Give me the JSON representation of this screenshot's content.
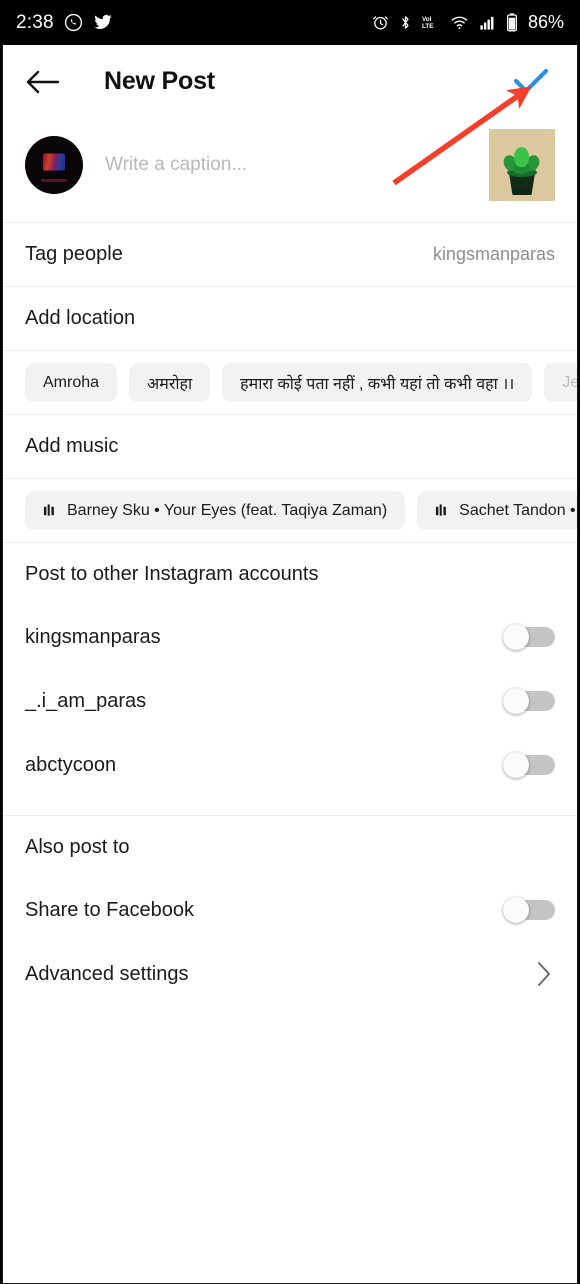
{
  "status_bar": {
    "time": "2:38",
    "battery_text": "86%",
    "left_icons": [
      "whatsapp-icon",
      "twitter-icon"
    ],
    "right_icons": [
      "alarm-icon",
      "bluetooth-icon",
      "volte-icon",
      "wifi-icon",
      "signal-icon",
      "battery-icon"
    ]
  },
  "header": {
    "back_label": "back-arrow",
    "title": "New Post",
    "share_label": "share-checkmark",
    "accent_color": "#2e8fe0"
  },
  "caption": {
    "placeholder": "Write a caption...",
    "avatar_label": "user-avatar",
    "thumbnail_label": "post-thumbnail"
  },
  "tag_people": {
    "label": "Tag people",
    "value": "kingsmanparas"
  },
  "add_location": {
    "label": "Add location",
    "chips": [
      {
        "text": "Amroha",
        "faded": false
      },
      {
        "text": "अमरोहा",
        "faded": false
      },
      {
        "text": "हमारा कोई पता नहीं , कभी यहां तो कभी वहा ।।",
        "faded": false
      },
      {
        "text": "Jewelle",
        "faded": true
      }
    ]
  },
  "add_music": {
    "label": "Add music",
    "chips": [
      {
        "text": "Barney Sku • Your Eyes (feat. Taqiya Zaman)",
        "faded": false
      },
      {
        "text": "Sachet Tandon • Maiyya Main",
        "faded": false
      }
    ]
  },
  "other_accounts": {
    "title": "Post to other Instagram accounts",
    "items": [
      {
        "name": "kingsmanparas",
        "enabled": false
      },
      {
        "name": "_.i_am_paras",
        "enabled": false
      },
      {
        "name": "abctycoon",
        "enabled": false
      }
    ]
  },
  "also_post_to": {
    "title": "Also post to",
    "items": [
      {
        "name": "Share to Facebook",
        "enabled": false
      }
    ]
  },
  "advanced_settings": {
    "label": "Advanced settings"
  },
  "annotation": {
    "type": "arrow",
    "color": "#f4402a",
    "points_to": "share-checkmark"
  }
}
